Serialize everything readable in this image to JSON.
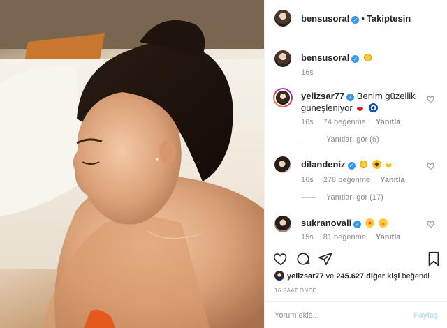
{
  "header": {
    "username": "bensusoral",
    "separator": "•",
    "follow_status": "Takiptesin"
  },
  "caption": {
    "username": "bensusoral",
    "time": "16s"
  },
  "comments": [
    {
      "username": "yelizsar77",
      "text": "Benim güzellik güneşleniyor",
      "time": "16s",
      "likes": "74 beğenme",
      "reply": "Yanıtla",
      "view_replies": "Yanıtları gör (6)"
    },
    {
      "username": "dilandeniz",
      "time": "16s",
      "likes": "278 beğenme",
      "reply": "Yanıtla",
      "view_replies": "Yanıtları gör (17)"
    },
    {
      "username": "sukranovali",
      "time": "15s",
      "likes": "81 beğenme",
      "reply": "Yanıtla"
    }
  ],
  "likes": {
    "first_liker": "yelizsar77",
    "connector": "ve",
    "others": "245.627 diğer kişi",
    "suffix": "beğendi"
  },
  "timestamp": "16 SAAT ÖNCE",
  "add_comment": {
    "placeholder": "Yorum ekle...",
    "post_label": "Paylaş"
  },
  "colors": {
    "verified": "#3897f0",
    "muted": "#8e8e8e",
    "post_disabled": "#b2dffc"
  }
}
